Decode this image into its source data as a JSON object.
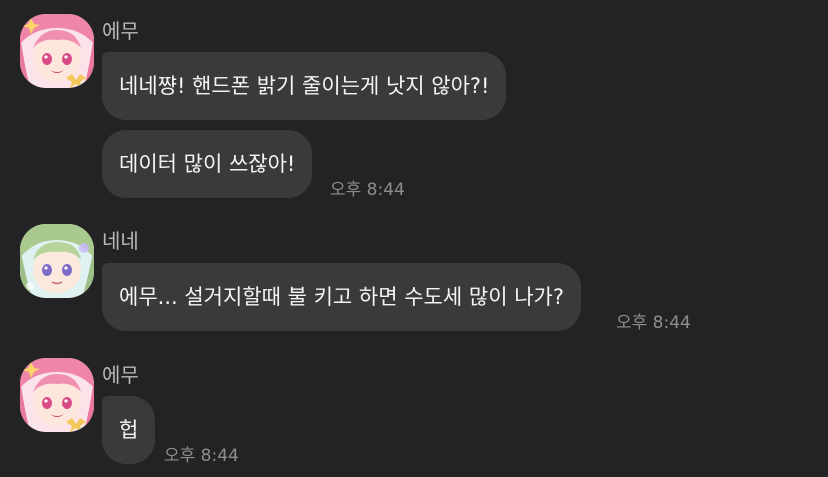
{
  "messages": [
    {
      "sender": "에무",
      "avatar": "emu-avatar",
      "bubbles": [
        "네네쨩! 핸드폰 밝기 줄이는게 낫지 않아?!",
        "데이터 많이 쓰잖아!"
      ],
      "time": "오후 8:44"
    },
    {
      "sender": "네네",
      "avatar": "nene-avatar",
      "bubbles": [
        "에무... 설거지할때 불 키고 하면 수도세 많이 나가?"
      ],
      "time": "오후 8:44"
    },
    {
      "sender": "에무",
      "avatar": "emu-avatar",
      "bubbles": [
        "헙"
      ],
      "time": "오후 8:44"
    }
  ],
  "colors": {
    "background": "#232325",
    "bubble": "#3a3a3c",
    "sender_text": "#b9b9bb",
    "time_text": "#8d8d90"
  }
}
